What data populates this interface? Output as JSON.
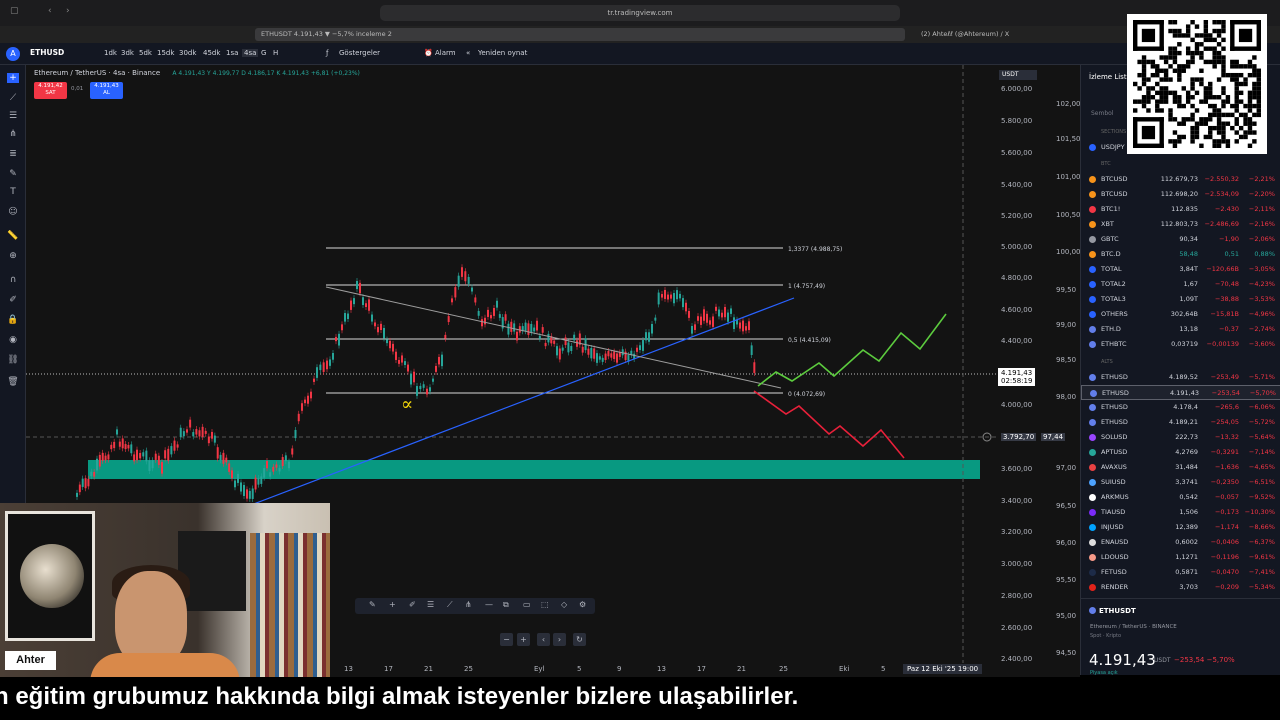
{
  "browser": {
    "url": "tr.tradingview.com",
    "tabs": [
      {
        "label": "ETHUSDT 4.191,43 ▼ −5,7% inceleme 2"
      },
      {
        "label": "(2) Ahteℓℓ (@Ahtereum) / X"
      }
    ]
  },
  "toolbar": {
    "symbol": "ETHUSD",
    "timeframes": [
      "1dk",
      "3dk",
      "5dk",
      "15dk",
      "30dk",
      "45dk",
      "1sa",
      "4sa",
      "G",
      "H"
    ],
    "selected_timeframe": "4sa",
    "indicators_label": "Göstergeler",
    "alarm_label": "Alarm",
    "replay_label": "Yeniden oynat"
  },
  "chart": {
    "title": "Ethereum / TetherUS · 4sa · Binance",
    "ohlc": "A 4.191,43  Y 4.199,77  D 4.186,17  K 4.191,43  +6,81 (+0,23%)",
    "sell_box": {
      "price": "4.191,42",
      "label": "SAT"
    },
    "buy_box": {
      "price": "4.191,43",
      "label": "AL"
    },
    "spread": "0,01",
    "currency_selector": "USDT",
    "price_labels": [
      "6.000,00",
      "5.800,00",
      "5.600,00",
      "5.400,00",
      "5.200,00",
      "5.000,00",
      "4.800,00",
      "4.600,00",
      "4.400,00",
      "4.000,00",
      "3.600,00",
      "3.400,00",
      "3.200,00",
      "3.000,00",
      "2.800,00",
      "2.600,00",
      "2.400,00"
    ],
    "secondary_labels": [
      "102,00",
      "101,50",
      "101,00",
      "100,50",
      "100,00",
      "99,50",
      "99,00",
      "98,50",
      "98,00",
      "97,00",
      "96,50",
      "96,00",
      "95,50",
      "95,00",
      "94,50"
    ],
    "current_price": "4.191,43",
    "countdown": "02:58:19",
    "crosshair_price": "3.792,70",
    "crosshair_secondary": "97,44",
    "fib_levels": [
      {
        "label": "1,3377 (4.988,75)"
      },
      {
        "label": "1 (4.757,49)"
      },
      {
        "label": "0,5 (4.415,09)"
      },
      {
        "label": "0 (4.072,69)"
      }
    ],
    "time_labels": [
      "13",
      "17",
      "21",
      "25",
      "Eyl",
      "5",
      "9",
      "13",
      "17",
      "21",
      "25",
      "Eki",
      "5"
    ],
    "time_highlight": "Paz 12 Eki '25  19:00",
    "colors": {
      "up": "#26a69a",
      "down": "#f23645",
      "zone": "#089981",
      "trend": "#2962ff",
      "bull_path": "#5ccb3e",
      "bear_path": "#e8203a"
    }
  },
  "watchlist": {
    "title": "İzleme Listesi",
    "symbol_header": "Sembol",
    "sections": [
      "SECTIONS",
      "BTC",
      "ALTS"
    ],
    "rows": [
      {
        "s": "USDJPY",
        "p": "",
        "c": "",
        "cp": "",
        "dot": "#2962ff"
      },
      {
        "s": "BTCUSD",
        "p": "112.679,73",
        "c": "−2.550,32",
        "cp": "−2,21%",
        "dot": "#f7931a"
      },
      {
        "s": "BTCUSD",
        "p": "112.698,20",
        "c": "−2.534,09",
        "cp": "−2,20%",
        "dot": "#f7931a"
      },
      {
        "s": "BTC1!",
        "p": "112.835",
        "c": "−2.430",
        "cp": "−2,11%",
        "dot": "#f23645"
      },
      {
        "s": "XBT",
        "p": "112.803,73",
        "c": "−2.486,69",
        "cp": "−2,16%",
        "dot": "#f7931a"
      },
      {
        "s": "GBTC",
        "p": "90,34",
        "c": "−1,90",
        "cp": "−2,06%",
        "dot": "#9598a1"
      },
      {
        "s": "BTC.D",
        "p": "58,48",
        "c": "0,51",
        "cp": "0,88%",
        "dot": "#f7931a"
      },
      {
        "s": "TOTAL",
        "p": "3,84T",
        "c": "−120,66B",
        "cp": "−3,05%",
        "dot": "#2962ff"
      },
      {
        "s": "TOTAL2",
        "p": "1,67",
        "c": "−70,48",
        "cp": "−4,23%",
        "dot": "#2962ff"
      },
      {
        "s": "TOTAL3",
        "p": "1,09T",
        "c": "−38,88",
        "cp": "−3,53%",
        "dot": "#2962ff"
      },
      {
        "s": "OTHERS",
        "p": "302,64B",
        "c": "−15,81B",
        "cp": "−4,96%",
        "dot": "#2962ff"
      },
      {
        "s": "ETH.D",
        "p": "13,18",
        "c": "−0,37",
        "cp": "−2,74%",
        "dot": "#627eea"
      },
      {
        "s": "ETHBTC",
        "p": "0,03719",
        "c": "−0,00139",
        "cp": "−3,60%",
        "dot": "#627eea"
      },
      {
        "s": "ETHUSD",
        "p": "4.189,52",
        "c": "−253,49",
        "cp": "−5,71%",
        "dot": "#627eea"
      },
      {
        "s": "ETHUSD",
        "p": "4.191,43",
        "c": "−253,54",
        "cp": "−5,70%",
        "dot": "#627eea",
        "sel": true
      },
      {
        "s": "ETHUSD",
        "p": "4.178,4",
        "c": "−265,6",
        "cp": "−6,06%",
        "dot": "#627eea"
      },
      {
        "s": "ETHUSD",
        "p": "4.189,21",
        "c": "−254,05",
        "cp": "−5,72%",
        "dot": "#627eea"
      },
      {
        "s": "SOLUSD",
        "p": "222,73",
        "c": "−13,32",
        "cp": "−5,64%",
        "dot": "#9945ff"
      },
      {
        "s": "APTUSD",
        "p": "4,2769",
        "c": "−0,3291",
        "cp": "−7,14%",
        "dot": "#26a69a"
      },
      {
        "s": "AVAXUS",
        "p": "31,484",
        "c": "−1,636",
        "cp": "−4,65%",
        "dot": "#e84142"
      },
      {
        "s": "SUIUSD",
        "p": "3,3741",
        "c": "−0,2350",
        "cp": "−6,51%",
        "dot": "#4da2ff"
      },
      {
        "s": "ARKMUS",
        "p": "0,542",
        "c": "−0,057",
        "cp": "−9,52%",
        "dot": "#fff"
      },
      {
        "s": "TIAUSD",
        "p": "1,506",
        "c": "−0,173",
        "cp": "−10,30%",
        "dot": "#7b2bf9"
      },
      {
        "s": "INJUSD",
        "p": "12,389",
        "c": "−1,174",
        "cp": "−8,66%",
        "dot": "#00a3ff"
      },
      {
        "s": "ENAUSD",
        "p": "0,6002",
        "c": "−0,0406",
        "cp": "−6,37%",
        "dot": "#ddd"
      },
      {
        "s": "LDOUSD",
        "p": "1,1271",
        "c": "−0,1196",
        "cp": "−9,61%",
        "dot": "#f69988"
      },
      {
        "s": "FETUSD",
        "p": "0,5871",
        "c": "−0,0470",
        "cp": "−7,41%",
        "dot": "#1d2b48"
      },
      {
        "s": "RENDER",
        "p": "3,703",
        "c": "−0,209",
        "cp": "−5,34%",
        "dot": "#e2231a"
      }
    ],
    "detail": {
      "symbol": "ETHUSDT",
      "description": "Ethereum / TetherUS · BINANCE",
      "category": "Spot · Kripto",
      "price": "4.191,43",
      "currency": "USDT",
      "change": "−253,54 −5,70%",
      "market_status": "Piyasa açık"
    }
  },
  "webcam": {
    "name": "Ahter"
  },
  "subtitle": "n eğitim grubumuz hakkında bilgi almak isteyenler bizlere ulaşabilirler."
}
